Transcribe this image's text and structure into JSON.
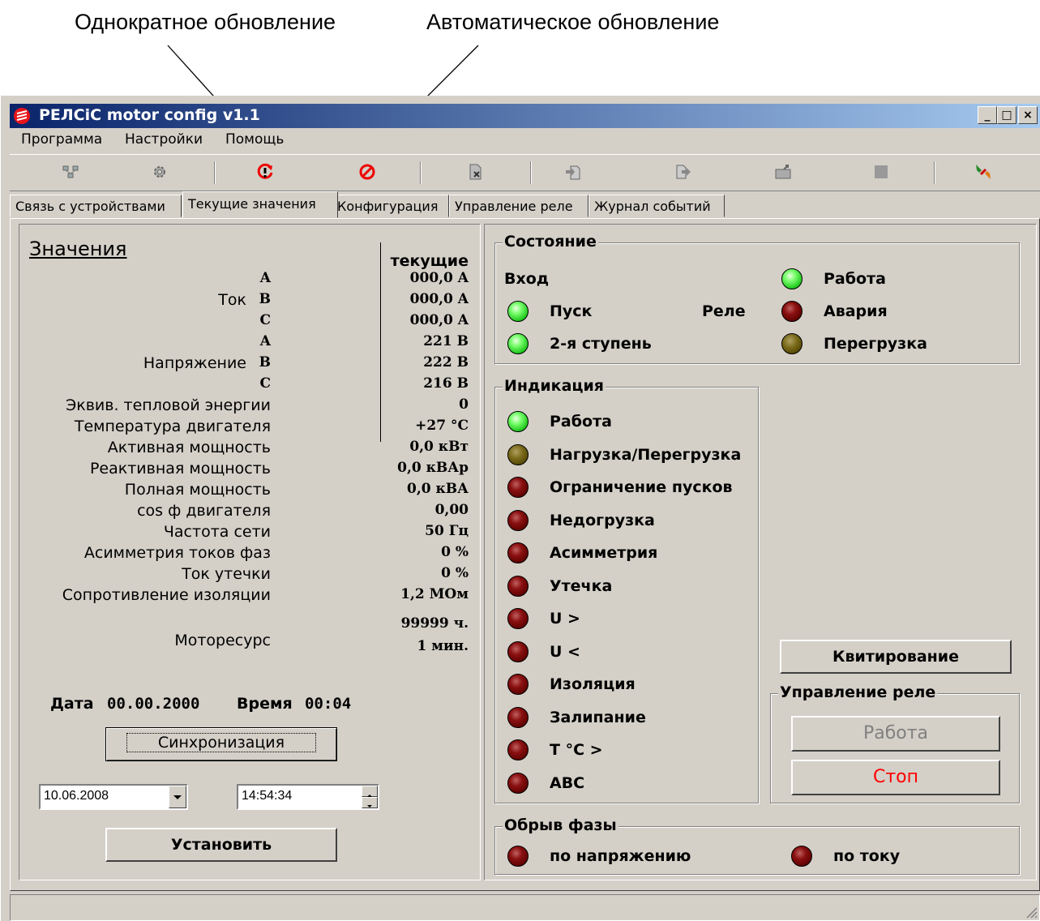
{
  "callouts": {
    "single_refresh": "Однократное обновление",
    "auto_refresh": "Автоматическое обновление"
  },
  "window": {
    "title": "РЕЛСiС motor config v1.1",
    "min_label": "_",
    "max_label": "□",
    "close_label": "×"
  },
  "menu": [
    "Программа",
    "Настройки",
    "Помощь"
  ],
  "toolbar_icons": [
    "network-icon",
    "settings-icon",
    "single-refresh-icon",
    "auto-refresh-icon",
    "delete-file-icon",
    "import-icon",
    "export-icon",
    "open-folder-icon",
    "stop-icon",
    "disconnect-icon"
  ],
  "tabs": [
    "Связь с устройствами",
    "Текущие значения",
    "Конфигурация",
    "Управление реле",
    "Журнал событий"
  ],
  "active_tab": "Текущие значения",
  "values": {
    "title": "Значения",
    "column_header": "текущие",
    "current_label": "Ток",
    "voltage_label": "Напряжение",
    "phases": [
      "A",
      "B",
      "C"
    ],
    "current": [
      "000,0 A",
      "000,0 A",
      "000,0 A"
    ],
    "voltage": [
      "221 B",
      "222 B",
      "216 B"
    ],
    "rows": [
      {
        "label": "Эквив. тепловой энергии",
        "value": "0"
      },
      {
        "label": "Температура двигателя",
        "value": "+27 °C"
      },
      {
        "label": "Активная мощность",
        "value": "0,0 кВт"
      },
      {
        "label": "Реактивная мощность",
        "value": "0,0 кВАр"
      },
      {
        "label": "Полная мощность",
        "value": "0,0 кВА"
      },
      {
        "label": "cos ф двигателя",
        "value": "0,00"
      },
      {
        "label": "Частота сети",
        "value": "50 Гц"
      },
      {
        "label": "Асимметрия токов фаз",
        "value": "0 %"
      },
      {
        "label": "Ток утечки",
        "value": "0 %"
      },
      {
        "label": "Сопротивление изоляции",
        "value": "1,2 МОм"
      }
    ],
    "motoresource_label": "Моторесурс",
    "motoresource_hours": "99999 ч.",
    "motoresource_min": "1 мин."
  },
  "datetime": {
    "date_label": "Дата",
    "date_value": "00.00.2000",
    "time_label": "Время",
    "time_value": "00:04",
    "sync_button": "Синхронизация",
    "date_input": "10.06.2008",
    "time_input": "14:54:34",
    "set_button": "Установить"
  },
  "state": {
    "title": "Состояние",
    "input_label": "Вход",
    "relay_label": "Реле",
    "inputs": [
      {
        "label": "Пуск",
        "color": "green"
      },
      {
        "label": "2-я ступень",
        "color": "green"
      }
    ],
    "relays": [
      {
        "label": "Работа",
        "color": "green"
      },
      {
        "label": "Авария",
        "color": "red"
      },
      {
        "label": "Перегрузка",
        "color": "olive"
      }
    ]
  },
  "indication": {
    "title": "Индикация",
    "items": [
      {
        "label": "Работа",
        "color": "green"
      },
      {
        "label": "Нагрузка/Перегрузка",
        "color": "olive"
      },
      {
        "label": "Ограничение пусков",
        "color": "red"
      },
      {
        "label": "Недогрузка",
        "color": "red"
      },
      {
        "label": "Асимметрия",
        "color": "red"
      },
      {
        "label": "Утечка",
        "color": "red"
      },
      {
        "label": "U >",
        "color": "red"
      },
      {
        "label": "U <",
        "color": "red"
      },
      {
        "label": "Изоляция",
        "color": "red"
      },
      {
        "label": "Залипание",
        "color": "red"
      },
      {
        "label": "T °C >",
        "color": "red"
      },
      {
        "label": "ABC",
        "color": "red"
      }
    ]
  },
  "ack_button": "Квитирование",
  "relay_control": {
    "title": "Управление реле",
    "work_button": "Работа",
    "stop_button": "Стоп",
    "stop_color": "#ff0000",
    "work_disabled_color": "#808080"
  },
  "phase_break": {
    "title": "Обрыв фазы",
    "by_voltage": "по напряжению",
    "by_current": "по току"
  }
}
